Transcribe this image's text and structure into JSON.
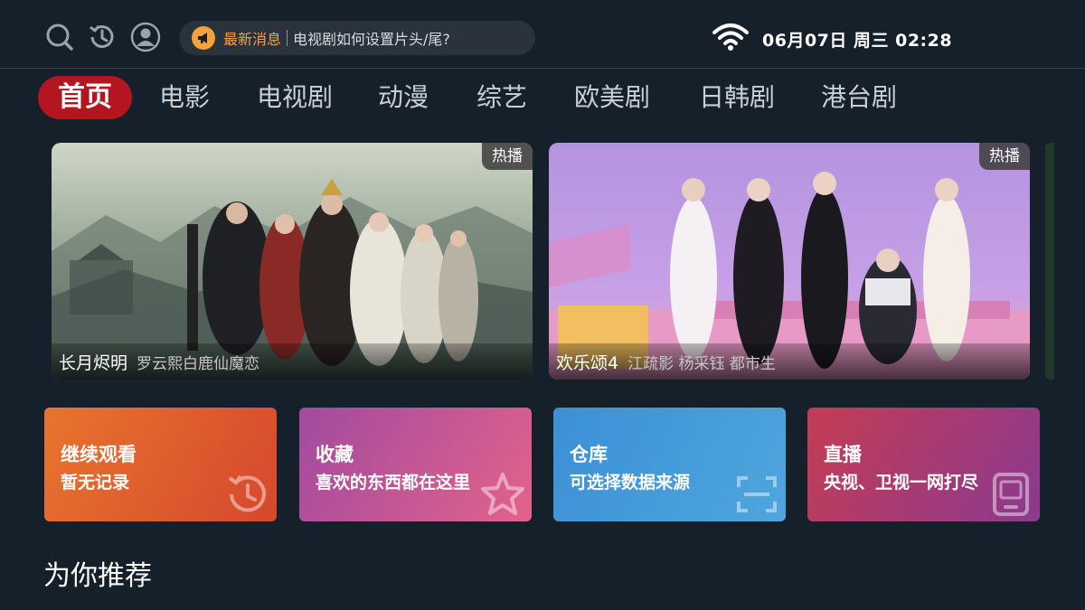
{
  "header": {
    "icons": [
      "search-icon",
      "history-icon",
      "user-icon"
    ],
    "notice_label": "最新消息",
    "notice_text": "电视剧如何设置片头/尾?",
    "clock": "06月07日 周三 02:28"
  },
  "tabs": [
    {
      "label": "首页",
      "active": true
    },
    {
      "label": "电影"
    },
    {
      "label": "电视剧"
    },
    {
      "label": "动漫"
    },
    {
      "label": "综艺"
    },
    {
      "label": "欧美剧"
    },
    {
      "label": "日韩剧"
    },
    {
      "label": "港台剧"
    }
  ],
  "banners": [
    {
      "badge": "热播",
      "title": "长月烬明",
      "subtitle": "罗云熙白鹿仙魔恋"
    },
    {
      "badge": "热播",
      "title": "欢乐颂4",
      "subtitle": "江疏影 杨采钰 都市生"
    }
  ],
  "cards": [
    {
      "title": "继续观看",
      "subtitle": "暂无记录",
      "icon": "history-icon",
      "color_from": "#e8742e",
      "color_to": "#d5482e"
    },
    {
      "title": "收藏",
      "subtitle": "喜欢的东西都在这里",
      "icon": "star-icon",
      "color_from": "#a24a9f",
      "color_to": "#e2638a"
    },
    {
      "title": "仓库",
      "subtitle": "可选择数据来源",
      "icon": "scan-icon",
      "color_from": "#3c8fd6",
      "color_to": "#4fa6dc"
    },
    {
      "title": "直播",
      "subtitle": "央视、卫视一网打尽",
      "icon": "tv-icon",
      "color_from": "#c43c54",
      "color_to": "#8a3a8f"
    }
  ],
  "section": {
    "title": "为你推荐"
  },
  "colors": {
    "accent": "#b3161e",
    "background": "#16202b"
  }
}
